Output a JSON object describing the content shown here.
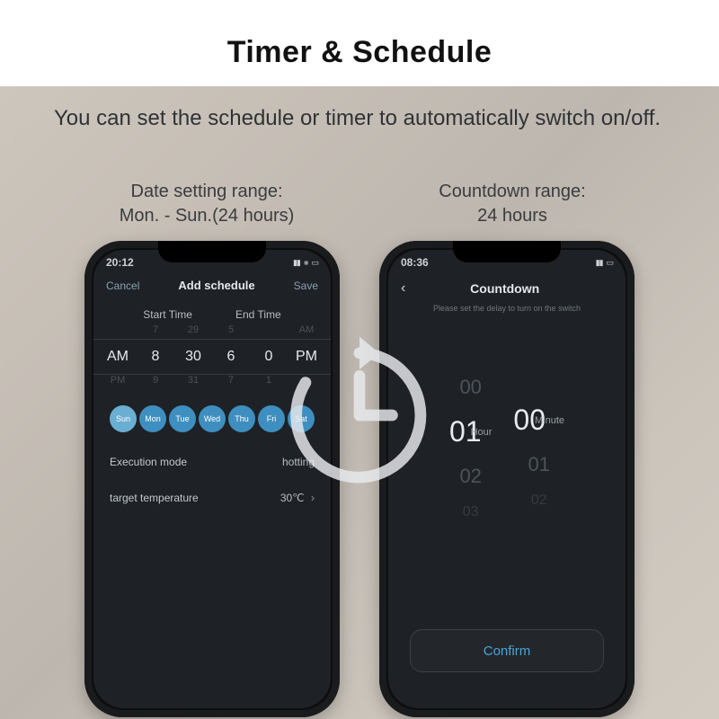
{
  "header": {
    "title": "Timer & Schedule",
    "subtitle": "You can set the schedule or timer to automatically switch on/off."
  },
  "captions": {
    "left_line1": "Date setting range:",
    "left_line2": "Mon. - Sun.(24 hours)",
    "right_line1": "Countdown range:",
    "right_line2": "24 hours"
  },
  "schedule_screen": {
    "status_time": "20:12",
    "cancel": "Cancel",
    "title": "Add schedule",
    "save": "Save",
    "start_label": "Start Time",
    "end_label": "End Time",
    "ghost_above": [
      "",
      "7",
      "29",
      "5",
      "",
      "AM"
    ],
    "ghost_below": [
      "PM",
      "9",
      "31",
      "7",
      "1",
      ""
    ],
    "picker": {
      "am": "AM",
      "h1": "8",
      "m1": "30",
      "h2": "6",
      "m2": "0",
      "pm": "PM"
    },
    "days": [
      "Sun",
      "Mon",
      "Tue",
      "Wed",
      "Thu",
      "Fri",
      "Sat"
    ],
    "exec_label": "Execution mode",
    "exec_value": "hotting",
    "temp_label": "target temperature",
    "temp_value": "30℃"
  },
  "countdown_screen": {
    "status_time": "08:36",
    "title": "Countdown",
    "hint": "Please set the delay to turn on the switch",
    "hour_unit": "Hour",
    "minute_unit": "Minute",
    "hours": {
      "above": "00",
      "cur": "01",
      "below": "02",
      "below2": "03"
    },
    "minutes": {
      "above": "",
      "cur": "00",
      "below": "01",
      "below2": "02"
    },
    "confirm": "Confirm"
  },
  "colors": {
    "accent": "#4aa3d8"
  }
}
